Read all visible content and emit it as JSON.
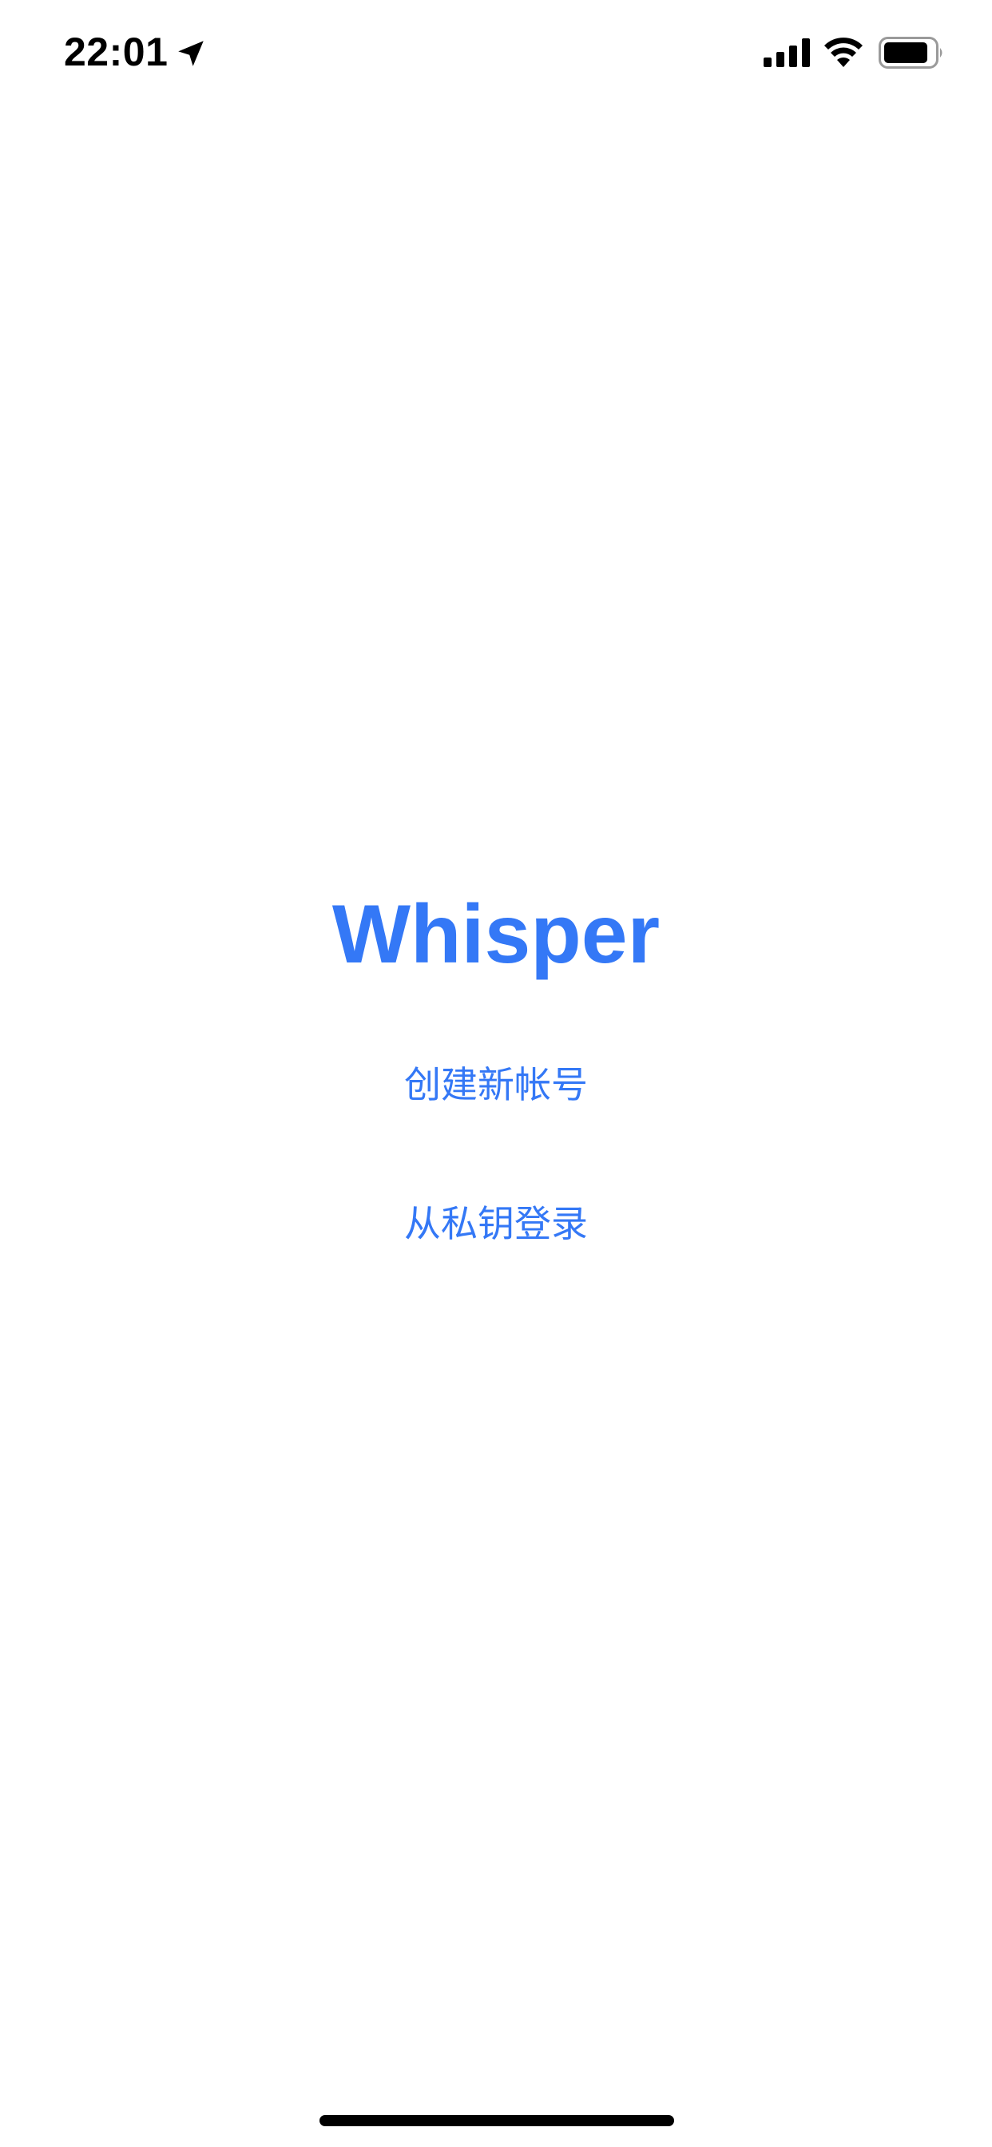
{
  "status_bar": {
    "time": "22:01",
    "icons": [
      "location-arrow-icon",
      "cellular-signal-icon",
      "wifi-icon",
      "battery-icon"
    ]
  },
  "main": {
    "title": "Whisper",
    "create_account_label": "创建新帐号",
    "login_private_key_label": "从私钥登录"
  },
  "colors": {
    "accent": "#3478f6",
    "background": "#ffffff",
    "status_text": "#000000"
  }
}
